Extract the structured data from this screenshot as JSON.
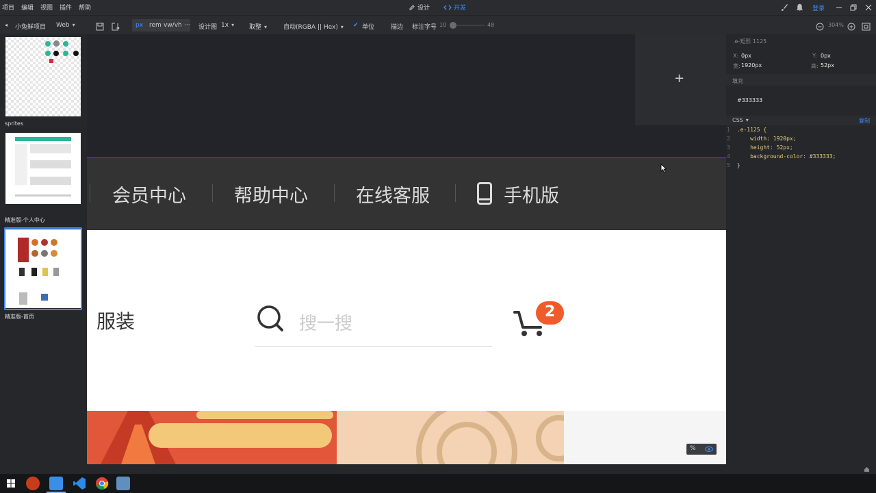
{
  "menu": [
    "项目",
    "编辑",
    "视图",
    "插件",
    "帮助"
  ],
  "modes": {
    "design": "设计",
    "dev": "开发"
  },
  "top_right": {
    "login": "登录"
  },
  "toolbar": {
    "project_name": "小兔鲜项目",
    "platform": "Web",
    "unit_px": "px",
    "unit_rem": "rem",
    "unit_vw": "vw/vh",
    "unit_more": "···",
    "design_label": "设计图",
    "design_scale": "1x",
    "rounding": "取整",
    "color_format": "自动(RGBA || Hex)",
    "unit_check": "单位",
    "stroke": "描边",
    "font_label": "标注字号",
    "font_min": "10",
    "font_max": "48",
    "zoom": "304%"
  },
  "pages": [
    {
      "label": "sprites"
    },
    {
      "label": "精准版-个人中心"
    },
    {
      "label": "精准版-首页"
    }
  ],
  "canvas": {
    "nav_items": [
      "会员中心",
      "帮助中心",
      "在线客服",
      "手机版"
    ],
    "category": "服装",
    "search_placeholder": "搜一搜",
    "cart_count": "2"
  },
  "inspector": {
    "layer_name": ".e-矩形 1125",
    "x_label": "X:",
    "x_value": "0px",
    "y_label": "Y:",
    "y_value": "0px",
    "w_label": "宽:",
    "w_value": "1920px",
    "h_label": "高:",
    "h_value": "52px",
    "fill_label": "填充",
    "fill_value": "#333333",
    "css_label": "CSS",
    "copy_label": "复制",
    "code_lines": [
      {
        "num": "1",
        "text": ".e-1125 {"
      },
      {
        "num": "2",
        "text": "    width: 1920px;"
      },
      {
        "num": "3",
        "text": "    height: 52px;"
      },
      {
        "num": "4",
        "text": "    background-color: #333333;"
      },
      {
        "num": "5",
        "text": "}"
      }
    ]
  },
  "colors": {
    "accent": "#3b8cff",
    "nav_bg": "#333333",
    "badge": "#f05b2a"
  }
}
